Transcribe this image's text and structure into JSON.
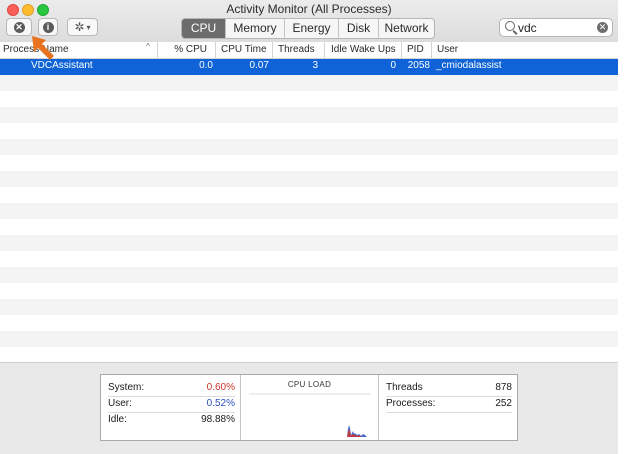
{
  "window": {
    "title": "Activity Monitor (All Processes)"
  },
  "toolbar": {
    "tabs": [
      {
        "label": "CPU",
        "active": true
      },
      {
        "label": "Memory",
        "active": false
      },
      {
        "label": "Energy",
        "active": false
      },
      {
        "label": "Disk",
        "active": false
      },
      {
        "label": "Network",
        "active": false
      }
    ],
    "stop_icon": "x-circle-icon",
    "info_icon": "info-icon",
    "gear_icon": "gear-icon",
    "search": {
      "value": "vdc",
      "icon": "search-icon"
    }
  },
  "table": {
    "columns": [
      "Process Name",
      "% CPU",
      "CPU Time",
      "Threads",
      "Idle Wake Ups",
      "PID",
      "User"
    ],
    "rows": [
      {
        "name": "VDCAssistant",
        "cpu": "0.0",
        "cpu_time": "0.07",
        "threads": "3",
        "idle_wake_ups": "0",
        "pid": "2058",
        "user": "_cmiodalassist"
      }
    ]
  },
  "stats": {
    "system_label": "System:",
    "system_value": "0.60%",
    "user_label": "User:",
    "user_value": "0.52%",
    "idle_label": "Idle:",
    "idle_value": "98.88%",
    "cpu_load_title": "CPU LOAD",
    "threads_label": "Threads",
    "threads_value": "878",
    "processes_label": "Processes:",
    "processes_value": "252"
  },
  "colors": {
    "selection": "#0f63d6",
    "system": "#d0342c",
    "user": "#2a4fbf",
    "pointer": "#e8731f"
  }
}
